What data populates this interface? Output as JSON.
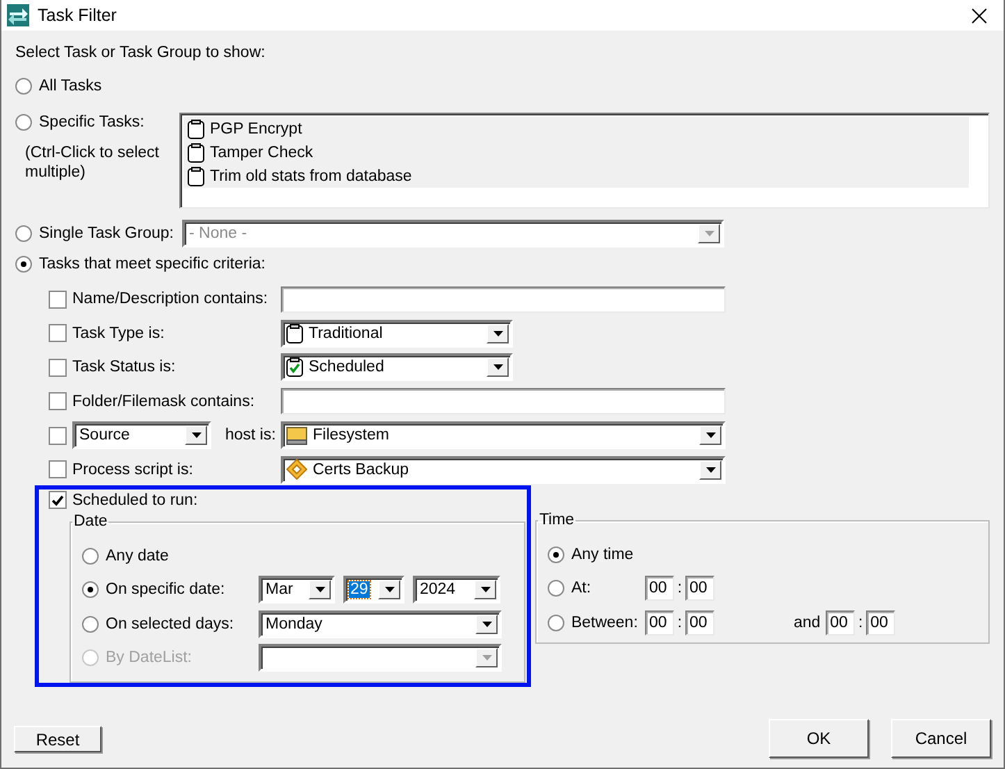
{
  "window": {
    "title": "Task Filter"
  },
  "prompt": "Select Task or Task Group to show:",
  "scope_options": [
    {
      "kind": "all",
      "label": "All Tasks",
      "selected": false
    },
    {
      "kind": "specific",
      "label": "Specific Tasks:",
      "note": "(Ctrl-Click to select multiple)",
      "selected": false,
      "tasks": [
        "PGP Encrypt",
        "Tamper Check",
        "Trim old stats from database"
      ]
    },
    {
      "kind": "group",
      "label": "Single Task Group:",
      "selected": false,
      "combo": {
        "value": "- None -",
        "disabled": true
      }
    },
    {
      "kind": "criteria",
      "label": "Tasks that meet specific criteria:",
      "selected": true
    }
  ],
  "criteria": [
    {
      "kind": "text",
      "label": "Name/Description contains:",
      "checked": false
    },
    {
      "kind": "combo",
      "label": "Task Type is:",
      "value": "Traditional",
      "checked": false
    },
    {
      "kind": "combo",
      "label": "Task Status is:",
      "value": "Scheduled",
      "checked": false
    },
    {
      "kind": "text",
      "label": "Folder/Filemask contains:",
      "checked": false
    },
    {
      "kind": "host",
      "side": "Source",
      "label": "host is:",
      "value": "Filesystem",
      "checked": false
    },
    {
      "kind": "wide",
      "label": "Process script is:",
      "value": "Certs Backup",
      "checked": false
    }
  ],
  "schedule": {
    "label": "Scheduled to run:",
    "checked": true,
    "highlighted": true,
    "date": {
      "title": "Date",
      "options": [
        {
          "kind": "plain",
          "label": "Any date",
          "selected": false,
          "disabled": false
        },
        {
          "kind": "date",
          "label": "On specific date:",
          "selected": true,
          "disabled": false,
          "fields": [
            {
              "value": "Mar",
              "selected": false
            },
            {
              "value": "29",
              "selected": true
            },
            {
              "value": "2024",
              "selected": false
            }
          ]
        },
        {
          "kind": "days",
          "label": "On selected days:",
          "selected": false,
          "disabled": false,
          "value": "Monday"
        },
        {
          "kind": "datelist",
          "label": "By DateList:",
          "selected": false,
          "disabled": true
        }
      ]
    },
    "time": {
      "title": "Time",
      "options": [
        {
          "kind": "any",
          "label": "Any time",
          "selected": true
        },
        {
          "kind": "at",
          "label": "At:",
          "selected": false,
          "start": {
            "hour": "00",
            "separator": ":",
            "minute": "00"
          }
        },
        {
          "kind": "between",
          "label": "Between:",
          "selected": false,
          "start": {
            "hour": "00",
            "separator": ":",
            "minute": "00"
          },
          "and_label": "and",
          "end": {
            "hour": "00",
            "separator": ":",
            "minute": "00"
          }
        }
      ]
    }
  },
  "buttons": {
    "reset": "Reset",
    "ok": "OK",
    "cancel": "Cancel"
  }
}
